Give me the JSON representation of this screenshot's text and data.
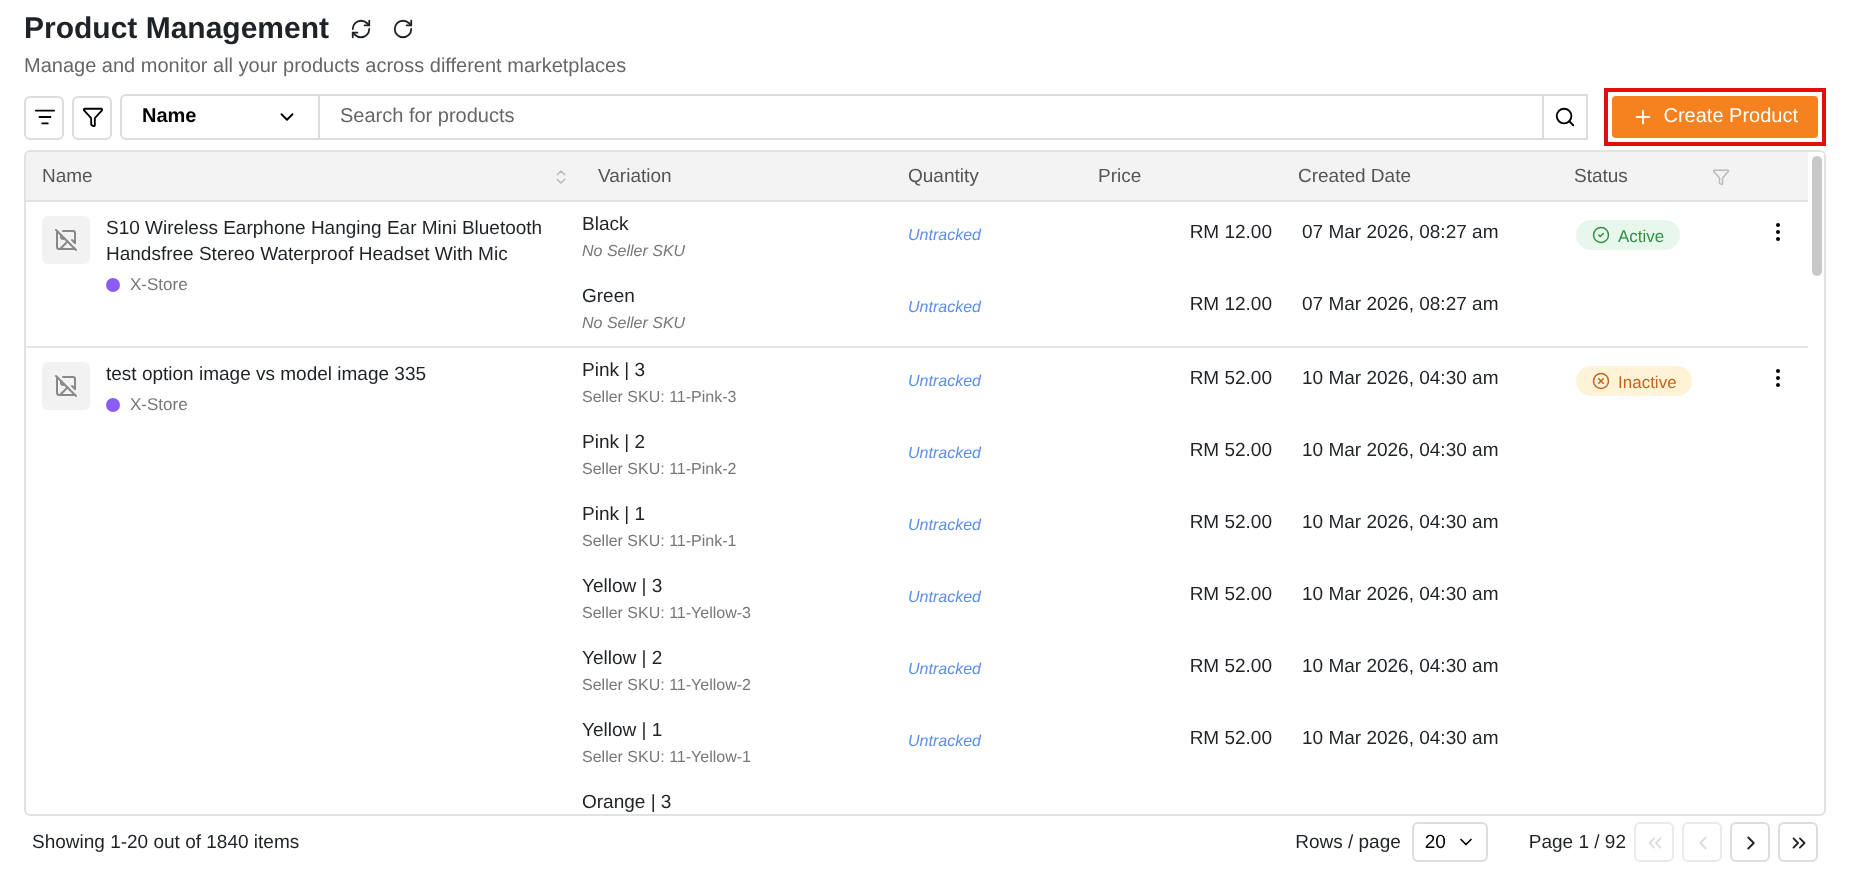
{
  "header": {
    "title": "Product Management",
    "subtitle": "Manage and monitor all your products across different marketplaces"
  },
  "toolbar": {
    "field_select": "Name",
    "search": {
      "placeholder": "Search for products"
    },
    "create_button": {
      "label": "Create Product",
      "highlighted": true
    }
  },
  "table": {
    "columns": [
      "Name",
      "Variation",
      "Quantity",
      "Price",
      "Created Date",
      "Status"
    ],
    "products": [
      {
        "name": "S10 Wireless Earphone Hanging Ear Mini Bluetooth Handsfree Stereo Waterproof Headset With Mic",
        "store": "X-Store",
        "status": {
          "label": "Active",
          "kind": "active"
        },
        "variations": [
          {
            "name": "Black",
            "sku": "No Seller SKU",
            "sku_missing": true,
            "quantity": "Untracked",
            "price": "RM 12.00",
            "created": "07 Mar 2026, 08:27 am"
          },
          {
            "name": "Green",
            "sku": "No Seller SKU",
            "sku_missing": true,
            "quantity": "Untracked",
            "price": "RM 12.00",
            "created": "07 Mar 2026, 08:27 am"
          }
        ]
      },
      {
        "name": "test option image vs model image 335",
        "store": "X-Store",
        "status": {
          "label": "Inactive",
          "kind": "inactive"
        },
        "variations": [
          {
            "name": "Pink | 3",
            "sku": "Seller SKU: 11-Pink-3",
            "sku_missing": false,
            "quantity": "Untracked",
            "price": "RM 52.00",
            "created": "10 Mar 2026, 04:30 am"
          },
          {
            "name": "Pink | 2",
            "sku": "Seller SKU: 11-Pink-2",
            "sku_missing": false,
            "quantity": "Untracked",
            "price": "RM 52.00",
            "created": "10 Mar 2026, 04:30 am"
          },
          {
            "name": "Pink | 1",
            "sku": "Seller SKU: 11-Pink-1",
            "sku_missing": false,
            "quantity": "Untracked",
            "price": "RM 52.00",
            "created": "10 Mar 2026, 04:30 am"
          },
          {
            "name": "Yellow | 3",
            "sku": "Seller SKU: 11-Yellow-3",
            "sku_missing": false,
            "quantity": "Untracked",
            "price": "RM 52.00",
            "created": "10 Mar 2026, 04:30 am"
          },
          {
            "name": "Yellow | 2",
            "sku": "Seller SKU: 11-Yellow-2",
            "sku_missing": false,
            "quantity": "Untracked",
            "price": "RM 52.00",
            "created": "10 Mar 2026, 04:30 am"
          },
          {
            "name": "Yellow | 1",
            "sku": "Seller SKU: 11-Yellow-1",
            "sku_missing": false,
            "quantity": "Untracked",
            "price": "RM 52.00",
            "created": "10 Mar 2026, 04:30 am"
          },
          {
            "name": "Orange | 3"
          }
        ]
      }
    ]
  },
  "footer": {
    "summary": "Showing 1-20 out of 1840 items",
    "rows_label": "Rows / page",
    "rows_value": "20",
    "page": "Page 1 / 92",
    "pager": [
      {
        "kind": "first",
        "disabled": true
      },
      {
        "kind": "prev",
        "disabled": true
      },
      {
        "kind": "next",
        "disabled": false
      },
      {
        "kind": "last",
        "disabled": false
      }
    ]
  }
}
